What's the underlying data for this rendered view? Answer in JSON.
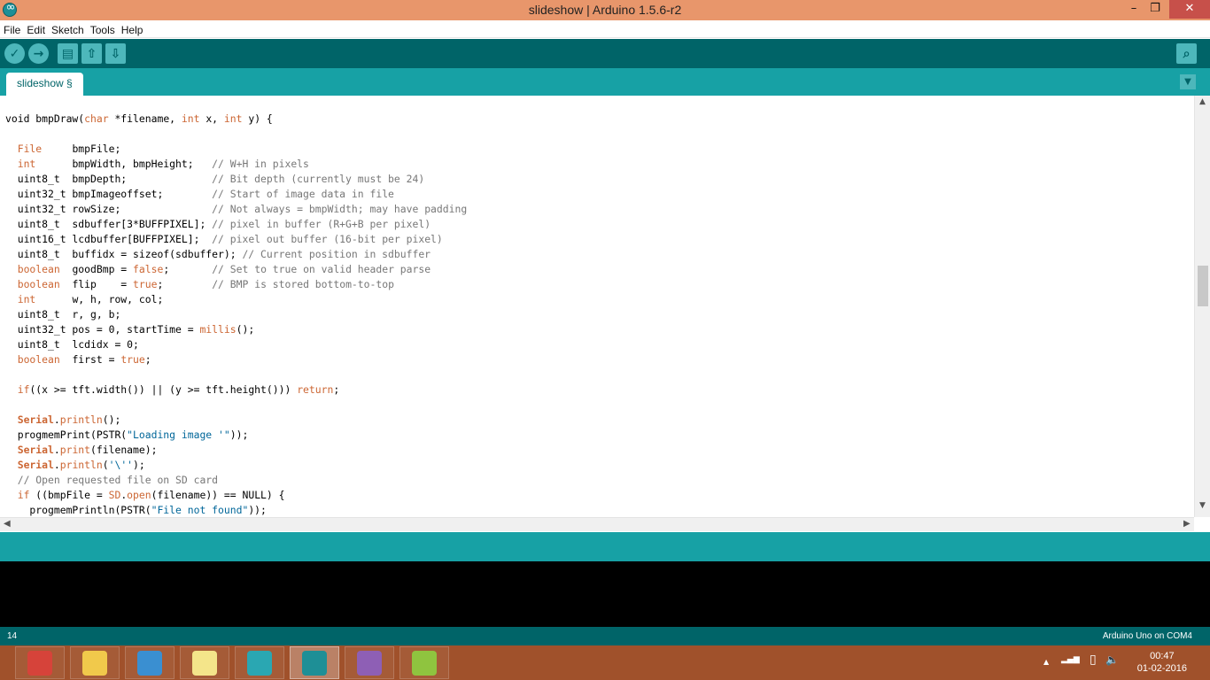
{
  "window": {
    "title": "slideshow | Arduino 1.5.6-r2",
    "minimize": "–",
    "maximize": "❐",
    "close": "✕"
  },
  "menu": [
    "File",
    "Edit",
    "Sketch",
    "Tools",
    "Help"
  ],
  "toolbar": {
    "verify_icon": "✓",
    "upload_icon": "→",
    "new_icon": "▤",
    "open_icon": "⇧",
    "save_icon": "⇩",
    "serial_monitor_icon": "⌕"
  },
  "tabs": [
    {
      "label": "slideshow §"
    }
  ],
  "tab_menu_icon": "▼",
  "code_lines": [
    [
      {
        "t": "void bmpDraw(",
        "c": ""
      },
      {
        "t": "char",
        "c": "kw"
      },
      {
        "t": " *filename, ",
        "c": ""
      },
      {
        "t": "int",
        "c": "kw"
      },
      {
        "t": " x, ",
        "c": ""
      },
      {
        "t": "int",
        "c": "kw"
      },
      {
        "t": " y) {",
        "c": ""
      }
    ],
    [],
    [
      {
        "t": "  ",
        "c": ""
      },
      {
        "t": "File",
        "c": "kw"
      },
      {
        "t": "     bmpFile;",
        "c": ""
      }
    ],
    [
      {
        "t": "  ",
        "c": ""
      },
      {
        "t": "int",
        "c": "kw"
      },
      {
        "t": "      bmpWidth, bmpHeight;   ",
        "c": ""
      },
      {
        "t": "// W+H in pixels",
        "c": "cm"
      }
    ],
    [
      {
        "t": "  uint8_t  bmpDepth;              ",
        "c": ""
      },
      {
        "t": "// Bit depth (currently must be 24)",
        "c": "cm"
      }
    ],
    [
      {
        "t": "  uint32_t bmpImageoffset;        ",
        "c": ""
      },
      {
        "t": "// Start of image data in file",
        "c": "cm"
      }
    ],
    [
      {
        "t": "  uint32_t rowSize;               ",
        "c": ""
      },
      {
        "t": "// Not always = bmpWidth; may have padding",
        "c": "cm"
      }
    ],
    [
      {
        "t": "  uint8_t  sdbuffer[3*BUFFPIXEL]; ",
        "c": ""
      },
      {
        "t": "// pixel in buffer (R+G+B per pixel)",
        "c": "cm"
      }
    ],
    [
      {
        "t": "  uint16_t lcdbuffer[BUFFPIXEL];  ",
        "c": ""
      },
      {
        "t": "// pixel out buffer (16-bit per pixel)",
        "c": "cm"
      }
    ],
    [
      {
        "t": "  uint8_t  buffidx = sizeof(sdbuffer); ",
        "c": ""
      },
      {
        "t": "// Current position in sdbuffer",
        "c": "cm"
      }
    ],
    [
      {
        "t": "  ",
        "c": ""
      },
      {
        "t": "boolean",
        "c": "kw"
      },
      {
        "t": "  goodBmp = ",
        "c": ""
      },
      {
        "t": "false",
        "c": "kw"
      },
      {
        "t": ";       ",
        "c": ""
      },
      {
        "t": "// Set to true on valid header parse",
        "c": "cm"
      }
    ],
    [
      {
        "t": "  ",
        "c": ""
      },
      {
        "t": "boolean",
        "c": "kw"
      },
      {
        "t": "  flip    = ",
        "c": ""
      },
      {
        "t": "true",
        "c": "kw"
      },
      {
        "t": ";        ",
        "c": ""
      },
      {
        "t": "// BMP is stored bottom-to-top",
        "c": "cm"
      }
    ],
    [
      {
        "t": "  ",
        "c": ""
      },
      {
        "t": "int",
        "c": "kw"
      },
      {
        "t": "      w, h, row, col;",
        "c": ""
      }
    ],
    [
      {
        "t": "  uint8_t  r, g, b;",
        "c": ""
      }
    ],
    [
      {
        "t": "  uint32_t pos = 0, startTime = ",
        "c": ""
      },
      {
        "t": "millis",
        "c": "kw"
      },
      {
        "t": "();",
        "c": ""
      }
    ],
    [
      {
        "t": "  uint8_t  lcdidx = 0;",
        "c": ""
      }
    ],
    [
      {
        "t": "  ",
        "c": ""
      },
      {
        "t": "boolean",
        "c": "kw"
      },
      {
        "t": "  first = ",
        "c": ""
      },
      {
        "t": "true",
        "c": "kw"
      },
      {
        "t": ";",
        "c": ""
      }
    ],
    [],
    [
      {
        "t": "  ",
        "c": ""
      },
      {
        "t": "if",
        "c": "kw"
      },
      {
        "t": "((x >= tft.width()) || (y >= tft.height())) ",
        "c": ""
      },
      {
        "t": "return",
        "c": "kw"
      },
      {
        "t": ";",
        "c": ""
      }
    ],
    [],
    [
      {
        "t": "  ",
        "c": ""
      },
      {
        "t": "Serial",
        "c": "fn"
      },
      {
        "t": ".",
        "c": ""
      },
      {
        "t": "println",
        "c": "kw"
      },
      {
        "t": "();",
        "c": ""
      }
    ],
    [
      {
        "t": "  progmemPrint(PSTR(",
        "c": ""
      },
      {
        "t": "\"Loading image '\"",
        "c": "st"
      },
      {
        "t": "));",
        "c": ""
      }
    ],
    [
      {
        "t": "  ",
        "c": ""
      },
      {
        "t": "Serial",
        "c": "fn"
      },
      {
        "t": ".",
        "c": ""
      },
      {
        "t": "print",
        "c": "kw"
      },
      {
        "t": "(filename);",
        "c": ""
      }
    ],
    [
      {
        "t": "  ",
        "c": ""
      },
      {
        "t": "Serial",
        "c": "fn"
      },
      {
        "t": ".",
        "c": ""
      },
      {
        "t": "println",
        "c": "kw"
      },
      {
        "t": "(",
        "c": ""
      },
      {
        "t": "'\\''",
        "c": "st"
      },
      {
        "t": ");",
        "c": ""
      }
    ],
    [
      {
        "t": "  ",
        "c": ""
      },
      {
        "t": "// Open requested file on SD card",
        "c": "cm"
      }
    ],
    [
      {
        "t": "  ",
        "c": ""
      },
      {
        "t": "if",
        "c": "kw"
      },
      {
        "t": " ((bmpFile = ",
        "c": ""
      },
      {
        "t": "SD",
        "c": "kw"
      },
      {
        "t": ".",
        "c": ""
      },
      {
        "t": "open",
        "c": "kw"
      },
      {
        "t": "(filename)) == NULL) {",
        "c": ""
      }
    ],
    [
      {
        "t": "    progmemPrintln(PSTR(",
        "c": ""
      },
      {
        "t": "\"File not found\"",
        "c": "st"
      },
      {
        "t": "));",
        "c": ""
      }
    ]
  ],
  "scroll": {
    "up": "▲",
    "down": "▼",
    "left": "◀",
    "right": "▶",
    "vertical_position": 0.35
  },
  "footer": {
    "line_number": "14",
    "board": "Arduino Uno on COM4"
  },
  "taskbar": {
    "apps": [
      {
        "name": "chrome",
        "color": "#d6433a",
        "active": false
      },
      {
        "name": "file-explorer",
        "color": "#f1c94b",
        "active": false
      },
      {
        "name": "photos",
        "color": "#3a8fd1",
        "active": false
      },
      {
        "name": "sticky-notes",
        "color": "#f4e58a",
        "active": false
      },
      {
        "name": "f-app",
        "color": "#2aa7b2",
        "active": false
      },
      {
        "name": "arduino",
        "color": "#1e8f96",
        "active": true
      },
      {
        "name": "picasa",
        "color": "#8e5fb5",
        "active": false
      },
      {
        "name": "notepad-plus",
        "color": "#8fc43f",
        "active": false
      }
    ],
    "tray": {
      "show_hidden": "▲",
      "signal": "▂▄▆",
      "battery": "▯",
      "volume": "🔈"
    },
    "time": "00:47",
    "date": "01-02-2016"
  }
}
